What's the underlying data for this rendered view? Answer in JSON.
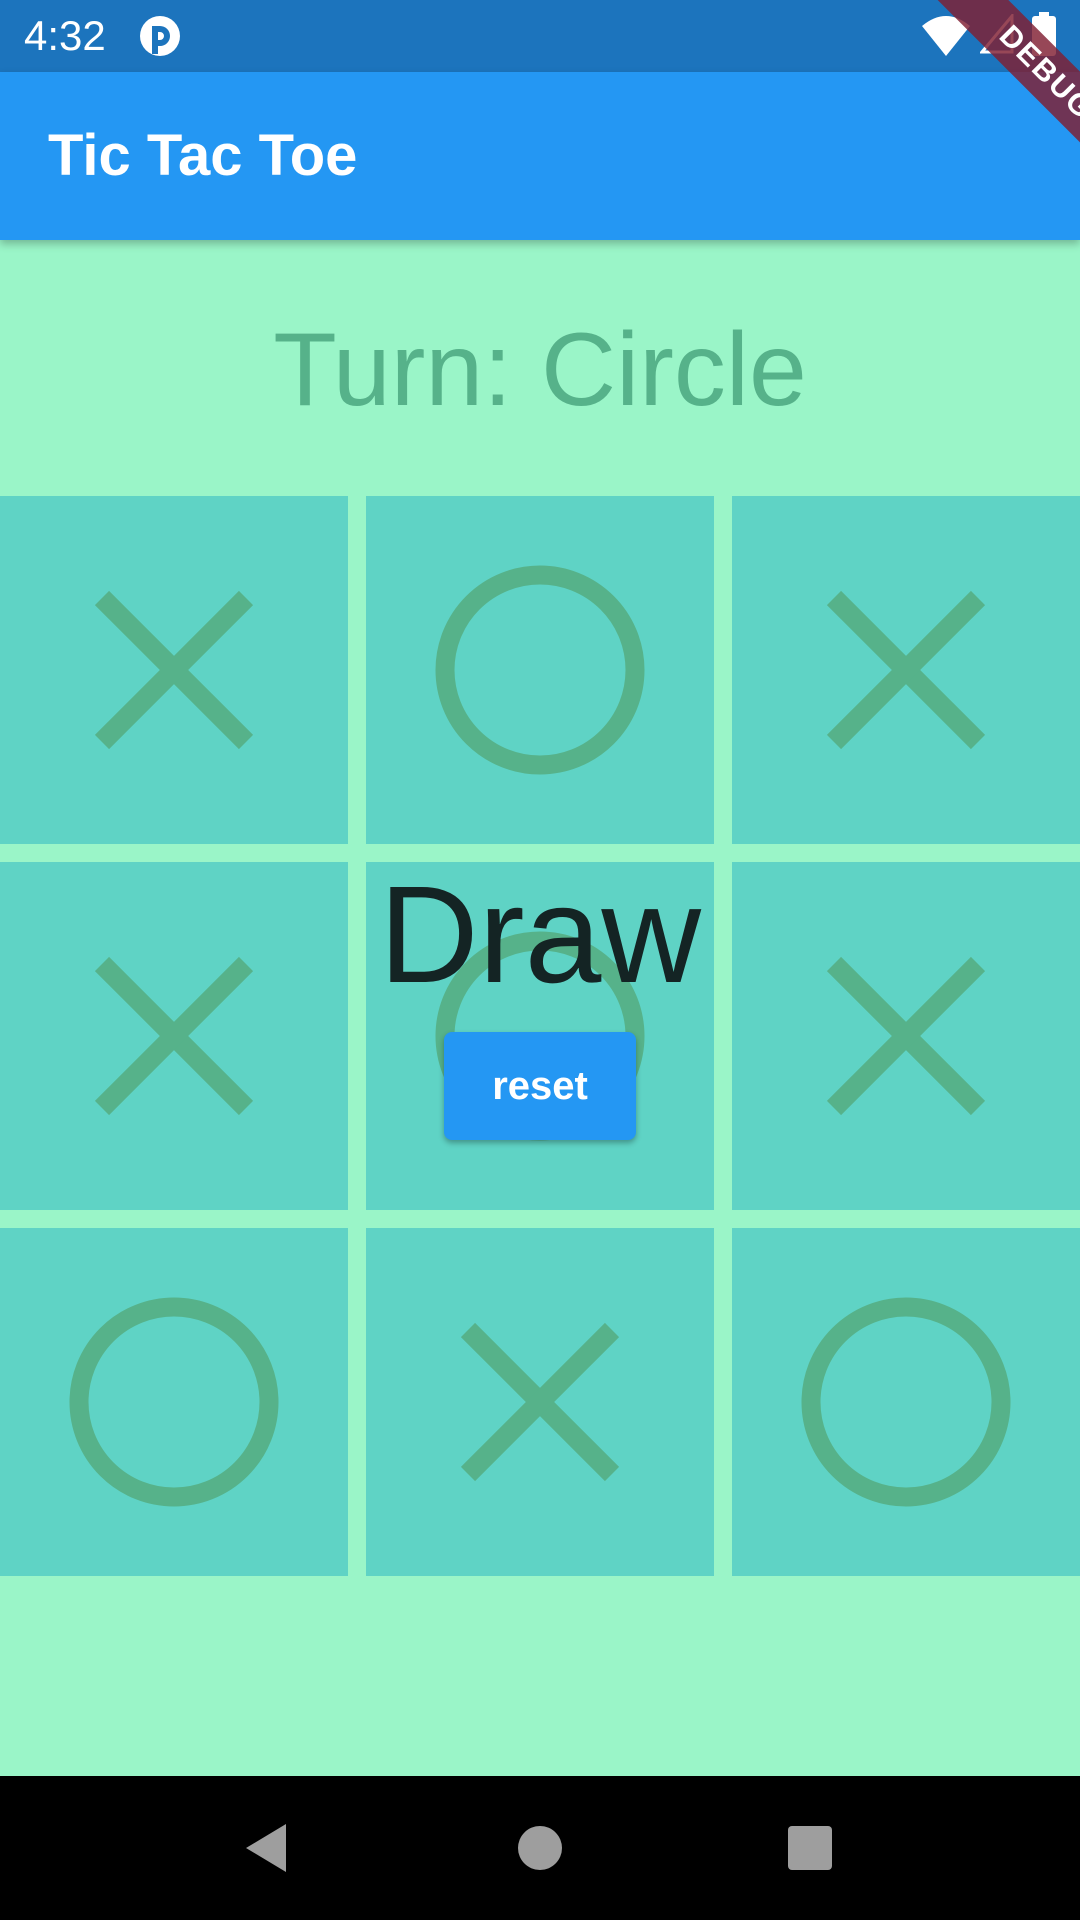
{
  "status_bar": {
    "time": "4:32",
    "icons": [
      "app-notification-icon",
      "wifi-icon",
      "signal-icon",
      "battery-icon"
    ]
  },
  "app_bar": {
    "title": "Tic Tac Toe"
  },
  "debug_banner": {
    "label": "DEBUG",
    "color": "#8B1E3A"
  },
  "game": {
    "turn_text": "Turn: Circle",
    "result_text": "Draw",
    "reset_label": "reset",
    "board": [
      [
        "X",
        "O",
        "X"
      ],
      [
        "X",
        "O",
        "X"
      ],
      [
        "O",
        "X",
        "O"
      ]
    ]
  },
  "nav_bar": {
    "buttons": [
      "back-icon",
      "home-icon",
      "recents-icon"
    ]
  },
  "colors": {
    "background": "#9AF5C8",
    "cell": "#5FD3C5",
    "mark": "#56B28A",
    "app_bar": "#2497F3",
    "status_bar": "#1C74BD"
  }
}
